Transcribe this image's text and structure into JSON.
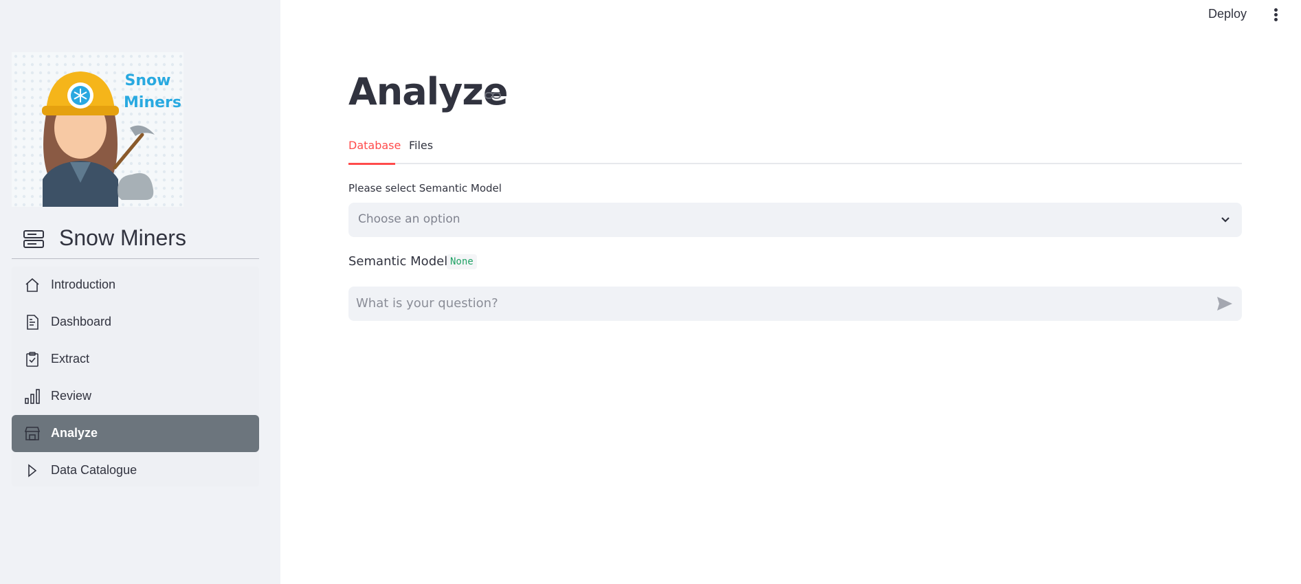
{
  "sidebar": {
    "logo": {
      "text_line1": "Snow",
      "text_line2": "Miners",
      "icon": "snow-miner-logo"
    },
    "brand": {
      "title": "Snow Miners",
      "icon": "server-stack-icon"
    },
    "items": [
      {
        "label": "Introduction",
        "icon": "house-icon",
        "active": false
      },
      {
        "label": "Dashboard",
        "icon": "document-icon",
        "active": false
      },
      {
        "label": "Extract",
        "icon": "clipboard-check-icon",
        "active": false
      },
      {
        "label": "Review",
        "icon": "bar-chart-icon",
        "active": false
      },
      {
        "label": "Analyze",
        "icon": "shop-icon",
        "active": true
      },
      {
        "label": "Data Catalogue",
        "icon": "play-outline-icon",
        "active": false
      }
    ]
  },
  "topbar": {
    "deploy_label": "Deploy",
    "menu_icon": "kebab-menu-icon"
  },
  "main": {
    "title": "Analyze",
    "tabs": [
      {
        "label": "Database",
        "active": true
      },
      {
        "label": "Files",
        "active": false
      }
    ],
    "select": {
      "label": "Please select Semantic Model",
      "placeholder": "Choose an option"
    },
    "semantic_model": {
      "label": "Semantic Model:",
      "value": "None"
    },
    "chat": {
      "placeholder": "What is your question?"
    }
  },
  "colors": {
    "accent": "#ff4b4b",
    "sidebar_bg": "#f0f2f6",
    "active_nav_bg": "#6c757d",
    "code_green": "#21a366",
    "text": "#31333f"
  }
}
